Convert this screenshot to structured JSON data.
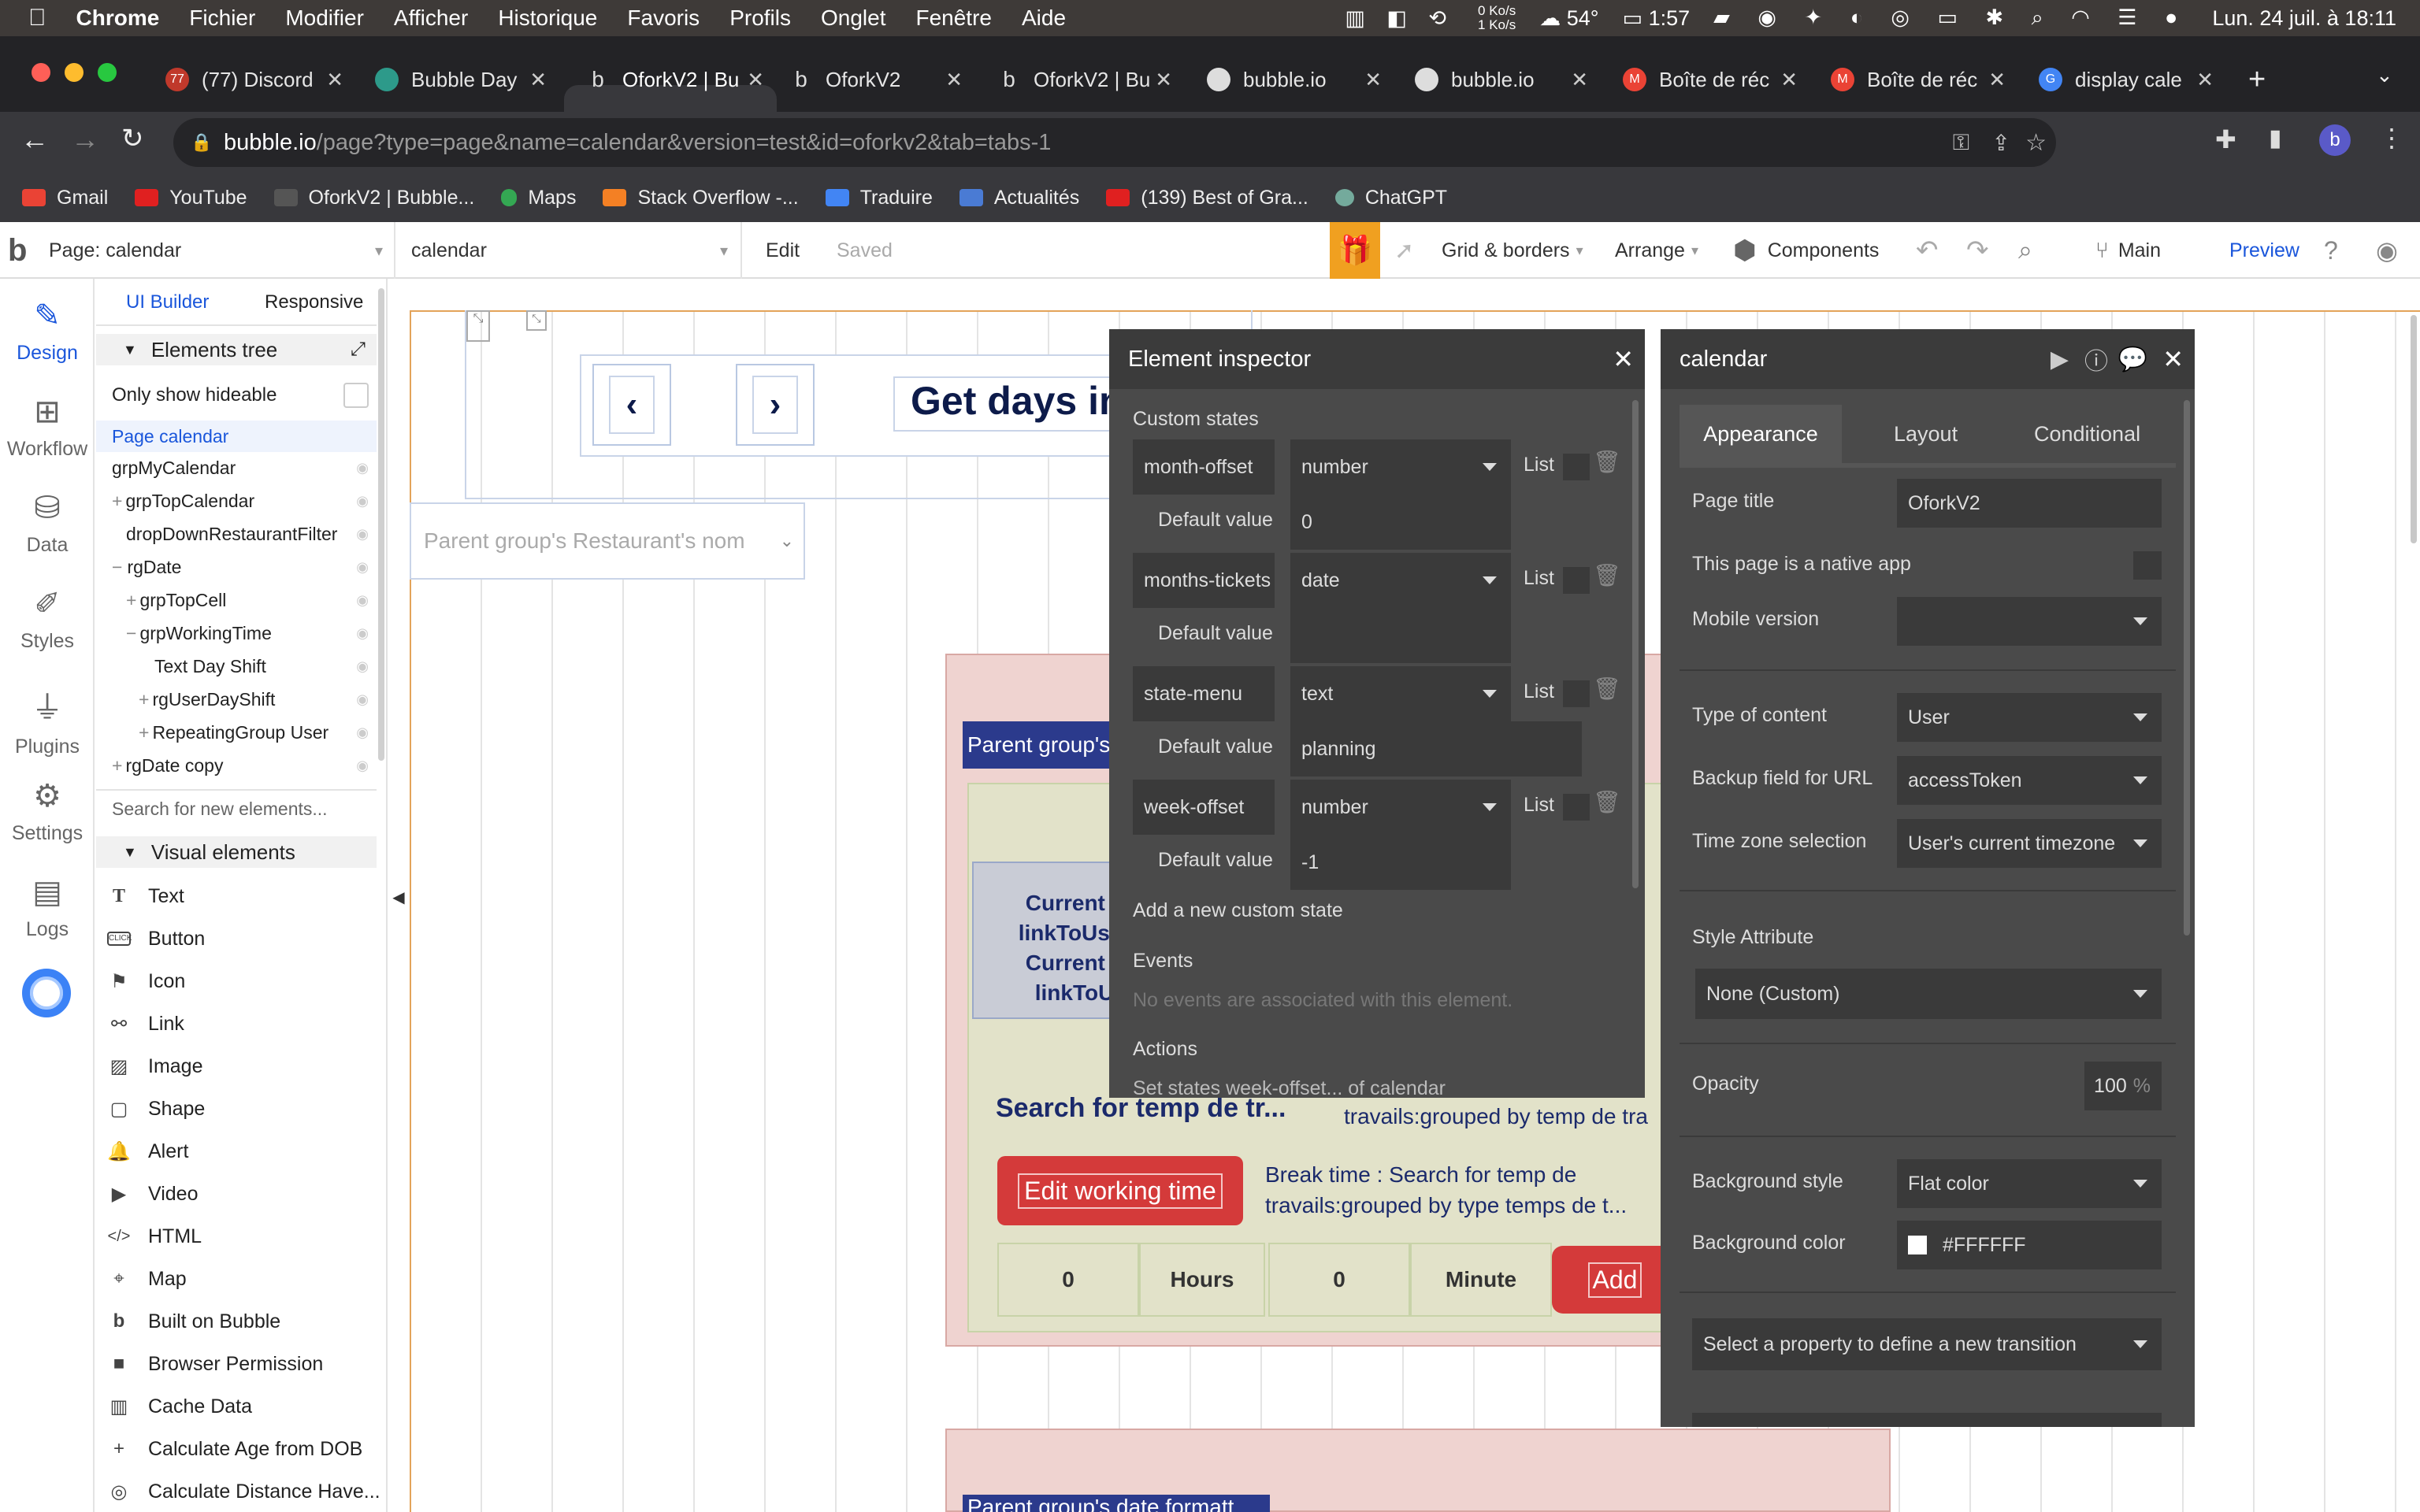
{
  "menubar": {
    "apple": "",
    "items": [
      "Chrome",
      "Fichier",
      "Modifier",
      "Afficher",
      "Historique",
      "Favoris",
      "Profils",
      "Onglet",
      "Fenêtre",
      "Aide"
    ],
    "net_up": "0 Ko/s",
    "net_down": "1 Ko/s",
    "temperature": "54°",
    "battery_time": "1:57",
    "datetime": "Lun. 24 juil. à 18:11"
  },
  "tabs": [
    {
      "label": "(77) Discord",
      "fav": "77"
    },
    {
      "label": "Bubble Day",
      "fav": ""
    },
    {
      "label": "OforkV2 | Bu",
      "fav": "b"
    },
    {
      "label": "OforkV2",
      "fav": "b"
    },
    {
      "label": "OforkV2 | Bu",
      "fav": "b"
    },
    {
      "label": "bubble.io",
      "fav": ""
    },
    {
      "label": "bubble.io",
      "fav": ""
    },
    {
      "label": "Boîte de réc",
      "fav": "M"
    },
    {
      "label": "Boîte de réc",
      "fav": "M"
    },
    {
      "label": "display cale",
      "fav": "G"
    }
  ],
  "address": {
    "host": "bubble.io",
    "path": "/page?type=page&name=calendar&version=test&id=oforkv2&tab=tabs-1",
    "profile": "b"
  },
  "bookmarks": [
    "Gmail",
    "YouTube",
    "OforkV2 | Bubble...",
    "Maps",
    "Stack Overflow -...",
    "Traduire",
    "Actualités",
    "(139) Best of Gra...",
    "ChatGPT"
  ],
  "editor": {
    "page_selector": "Page: calendar",
    "element_selector": "calendar",
    "edit": "Edit",
    "saved": "Saved",
    "grid_borders": "Grid & borders",
    "arrange": "Arrange",
    "components": "Components",
    "branch": "Main",
    "preview": "Preview"
  },
  "leftnav": [
    "Design",
    "Workflow",
    "Data",
    "Styles",
    "Plugins",
    "Settings",
    "Logs"
  ],
  "tree": {
    "tab_builder": "UI Builder",
    "tab_responsive": "Responsive",
    "elements_tree": "Elements tree",
    "only_hideable": "Only show hideable",
    "items": [
      "Page calendar",
      "grpMyCalendar",
      "grpTopCalendar",
      "dropDownRestaurantFilter",
      "rgDate",
      "grpTopCell",
      "grpWorkingTime",
      "Text Day Shift",
      "rgUserDayShift",
      "RepeatingGroup User",
      "rgDate copy"
    ],
    "search_placeholder": "Search for new elements...",
    "visual_elements": "Visual elements",
    "visual": [
      "Text",
      "Button",
      "Icon",
      "Link",
      "Image",
      "Shape",
      "Alert",
      "Video",
      "HTML",
      "Map",
      "Built on Bubble",
      "Browser Permission",
      "Cache Data",
      "Calculate Age from DOB",
      "Calculate Distance Have..."
    ]
  },
  "canvas": {
    "title_text": "Get days in v",
    "dropdown_placeholder": "Parent group's Restaurant's nom",
    "parent_label": "Parent group's",
    "current_lines": [
      "Current c",
      "linkToUser",
      "Current c",
      "linkToU"
    ],
    "search_text": "Search for temp de tr...",
    "travails_text": "travails:grouped by temp de tra",
    "edit_working_time": "Edit working time",
    "break_time": "Break time : Search for temp de travails:grouped by type temps de t...",
    "hours_value": "0",
    "hours_label": "Hours",
    "minutes_value": "0",
    "minutes_label": "Minute",
    "add_label": "Add",
    "bottom_label": "Parent group's date formatt..."
  },
  "inspector": {
    "title": "Element inspector",
    "custom_states": "Custom states",
    "states": [
      {
        "name": "month-offset",
        "type": "number",
        "list": "List",
        "default_label": "Default value",
        "default": "0"
      },
      {
        "name": "months-tickets",
        "type": "date",
        "list": "List",
        "default_label": "Default value",
        "default": ""
      },
      {
        "name": "state-menu",
        "type": "text",
        "list": "List",
        "default_label": "Default value",
        "default": "planning"
      },
      {
        "name": "week-offset",
        "type": "number",
        "list": "List",
        "default_label": "Default value",
        "default": "-1"
      }
    ],
    "add_state": "Add a new custom state",
    "events": "Events",
    "no_events": "No events are associated with this element.",
    "actions": "Actions",
    "action_text": "Set states week-offset... of calendar"
  },
  "props": {
    "title": "calendar",
    "tabs": [
      "Appearance",
      "Layout",
      "Conditional"
    ],
    "page_title_label": "Page title",
    "page_title": "OforkV2",
    "native_app": "This page is a native app",
    "mobile_version": "Mobile version",
    "type_content_label": "Type of content",
    "type_content": "User",
    "backup_label": "Backup field for URL",
    "backup": "accessToken",
    "tz_label": "Time zone selection",
    "tz": "User's current timezone",
    "style_attr": "Style Attribute",
    "style_value": "None (Custom)",
    "opacity_label": "Opacity",
    "opacity": "100",
    "opacity_unit": "%",
    "bg_style_label": "Background style",
    "bg_style": "Flat color",
    "bg_color_label": "Background color",
    "bg_color": "#FFFFFF",
    "transition": "Select a property to define a new transition"
  },
  "colors": {
    "accent": "#1a56db",
    "red_button": "#d43a3a",
    "gift": "#f0a020"
  }
}
